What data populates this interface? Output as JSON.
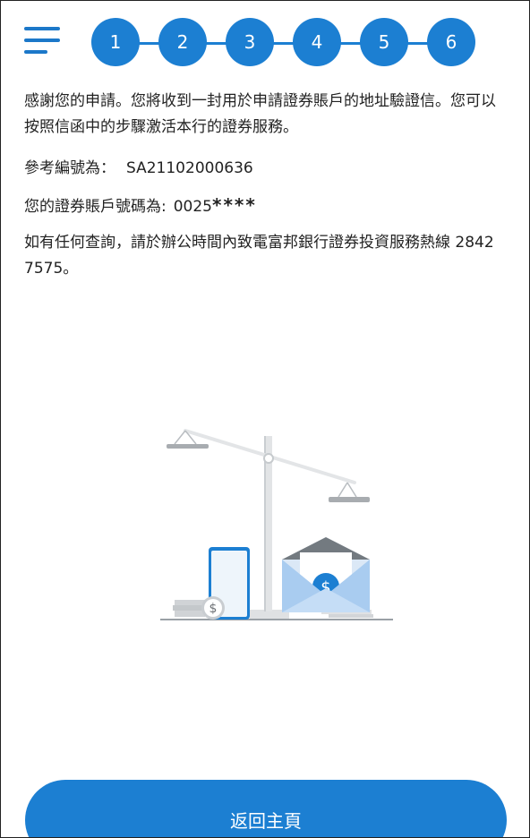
{
  "stepper": {
    "steps": [
      "1",
      "2",
      "3",
      "4",
      "5",
      "6"
    ]
  },
  "message": {
    "intro": "感謝您的申請。您將收到一封用於申請證券賬戶的地址驗證信。您可以按照信函中的步驟激活本行的證券服務。",
    "reference_label": "參考編號為：",
    "reference_value": "SA21102000636",
    "account_label": "您的證券賬戶號碼為:",
    "account_prefix": "0025",
    "account_mask": "****",
    "enquiry": "如有任何查詢，請於辦公時間內致電富邦銀行證券投資服務熱線 2842 7575。"
  },
  "illustration": {
    "icon": "scale-phone-envelope-illustration",
    "coin_symbol": "$",
    "envelope_symbol": "$"
  },
  "actions": {
    "home_label": "返回主頁"
  },
  "colors": {
    "accent": "#1c7fd2",
    "menu": "#1c78c9",
    "text": "#222222"
  }
}
